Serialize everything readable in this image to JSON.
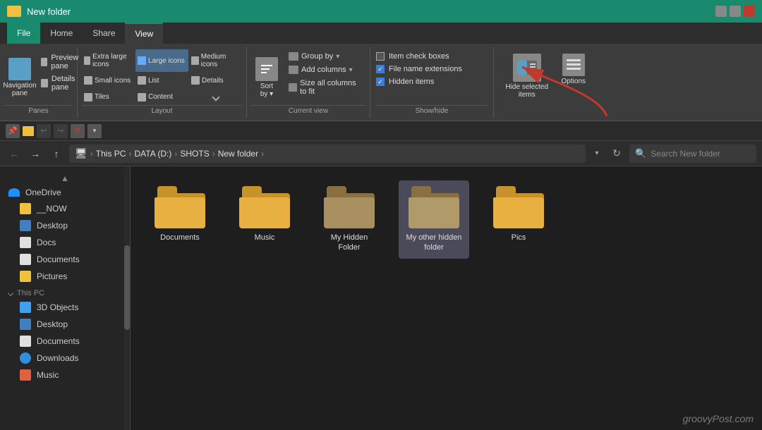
{
  "titlebar": {
    "title": "New folder",
    "icon": "folder",
    "controls": [
      "minimize",
      "maximize",
      "close"
    ]
  },
  "tabs": {
    "items": [
      {
        "label": "File",
        "active": false,
        "file": true
      },
      {
        "label": "Home",
        "active": false
      },
      {
        "label": "Share",
        "active": false
      },
      {
        "label": "View",
        "active": true
      }
    ]
  },
  "ribbon": {
    "panes_label": "Panes",
    "layout_label": "Layout",
    "currentview_label": "Current view",
    "showhide_label": "Show/hide",
    "nav_pane_label": "Navigation pane",
    "preview_pane_label": "Preview pane",
    "details_pane_label": "Details pane",
    "extra_large_label": "Extra large icons",
    "large_icons_label": "Large icons",
    "medium_icons_label": "Medium icons",
    "small_icons_label": "Small icons",
    "list_label": "List",
    "details_label": "Details",
    "tiles_label": "Tiles",
    "content_label": "Content",
    "sort_by_label": "Sort by",
    "group_by_label": "Group by",
    "add_columns_label": "Add columns",
    "size_all_cols_label": "Size all columns to fit",
    "item_checkboxes_label": "Item check boxes",
    "file_name_ext_label": "File name extensions",
    "hidden_items_label": "Hidden items",
    "hide_selected_label": "Hide selected items",
    "options_label": "Options"
  },
  "addressbar": {
    "path_parts": [
      "This PC",
      "DATA (D:)",
      "SHOTS",
      "New folder"
    ],
    "search_placeholder": "Search New folder"
  },
  "quickaccess": {
    "undo": "↩",
    "redo": "↪",
    "delete": "✕"
  },
  "sidebar": {
    "onedrive_label": "OneDrive",
    "now_label": "__NOW",
    "desktop_label": "Desktop",
    "docs_label": "Docs",
    "documents_label": "Documents",
    "pictures_label": "Pictures",
    "thispc_label": "This PC",
    "objects3d_label": "3D Objects",
    "desktop2_label": "Desktop",
    "documents2_label": "Documents",
    "downloads_label": "Downloads",
    "music_label": "Music"
  },
  "files": [
    {
      "name": "Documents",
      "type": "normal",
      "selected": false
    },
    {
      "name": "Music",
      "type": "normal",
      "selected": false
    },
    {
      "name": "My Hidden Folder",
      "type": "hidden",
      "selected": false
    },
    {
      "name": "My other hidden folder",
      "type": "selected-hidden",
      "selected": true
    },
    {
      "name": "Pics",
      "type": "normal",
      "selected": false
    }
  ],
  "watermark": "groovyPost.com",
  "checkboxes": {
    "item_checkboxes": false,
    "file_name_extensions": true,
    "hidden_items": true
  }
}
